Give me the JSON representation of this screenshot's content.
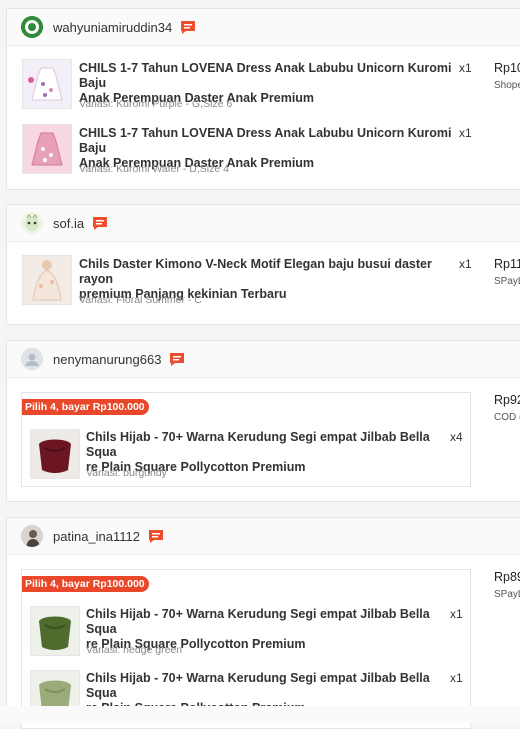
{
  "orders": [
    {
      "username": "wahyuniamiruddin34",
      "avatar_icon": "green-logo-avatar",
      "price": "Rp10",
      "payment": "Shope",
      "items": [
        {
          "title_l1": "CHILS 1-7 Tahun LOVENA Dress Anak Labubu Unicorn Kuromi Baju",
          "title_l2": "Anak Perempuan Daster Anak Premium",
          "variant": "Variasi: Kuromi Purple - G,Size 6",
          "qty": "x1"
        },
        {
          "title_l1": "CHILS 1-7 Tahun LOVENA Dress Anak Labubu Unicorn Kuromi Baju",
          "title_l2": "Anak Perempuan Daster Anak Premium",
          "variant": "Variasi: Kuromi Wafer - D,Size 4",
          "qty": "x1"
        }
      ]
    },
    {
      "username": "sof.ia",
      "avatar_icon": "cartoon-avatar",
      "price": "Rp11",
      "payment": "SPayL",
      "items": [
        {
          "title_l1": "Chils Daster Kimono V-Neck Motif Elegan baju busui daster rayon",
          "title_l2": "premium Panjang kekinian Terbaru",
          "variant": "Variasi: Floral Summer - C",
          "qty": "x1"
        }
      ]
    },
    {
      "username": "nenymanurung663",
      "avatar_icon": "default-user-avatar",
      "price": "Rp92",
      "payment": "COD (",
      "promo": "Pilih 4, bayar Rp100.000",
      "items": [
        {
          "title_l1": "Chils Hijab - 70+ Warna Kerudung Segi empat Jilbab Bella Squa",
          "title_l2": "re Plain Square Pollycotton Premium",
          "variant": "Variasi: burgundy",
          "qty": "x4"
        }
      ]
    },
    {
      "username": "patina_ina1112",
      "avatar_icon": "photo-avatar",
      "price": "Rp89",
      "payment": "SPayL",
      "promo": "Pilih 4, bayar Rp100.000",
      "items": [
        {
          "title_l1": "Chils Hijab - 70+ Warna Kerudung Segi empat Jilbab Bella Squa",
          "title_l2": "re Plain Square Pollycotton Premium",
          "variant": "Variasi: hedge green",
          "qty": "x1"
        },
        {
          "title_l1": "Chils Hijab - 70+ Warna Kerudung Segi empat Jilbab Bella Squa",
          "title_l2": "re Plain Square Pollycotton Premium",
          "variant": "",
          "qty": "x1"
        }
      ]
    }
  ],
  "colors": {
    "accent": "#ee4d2d",
    "promo": "#e8472a"
  }
}
